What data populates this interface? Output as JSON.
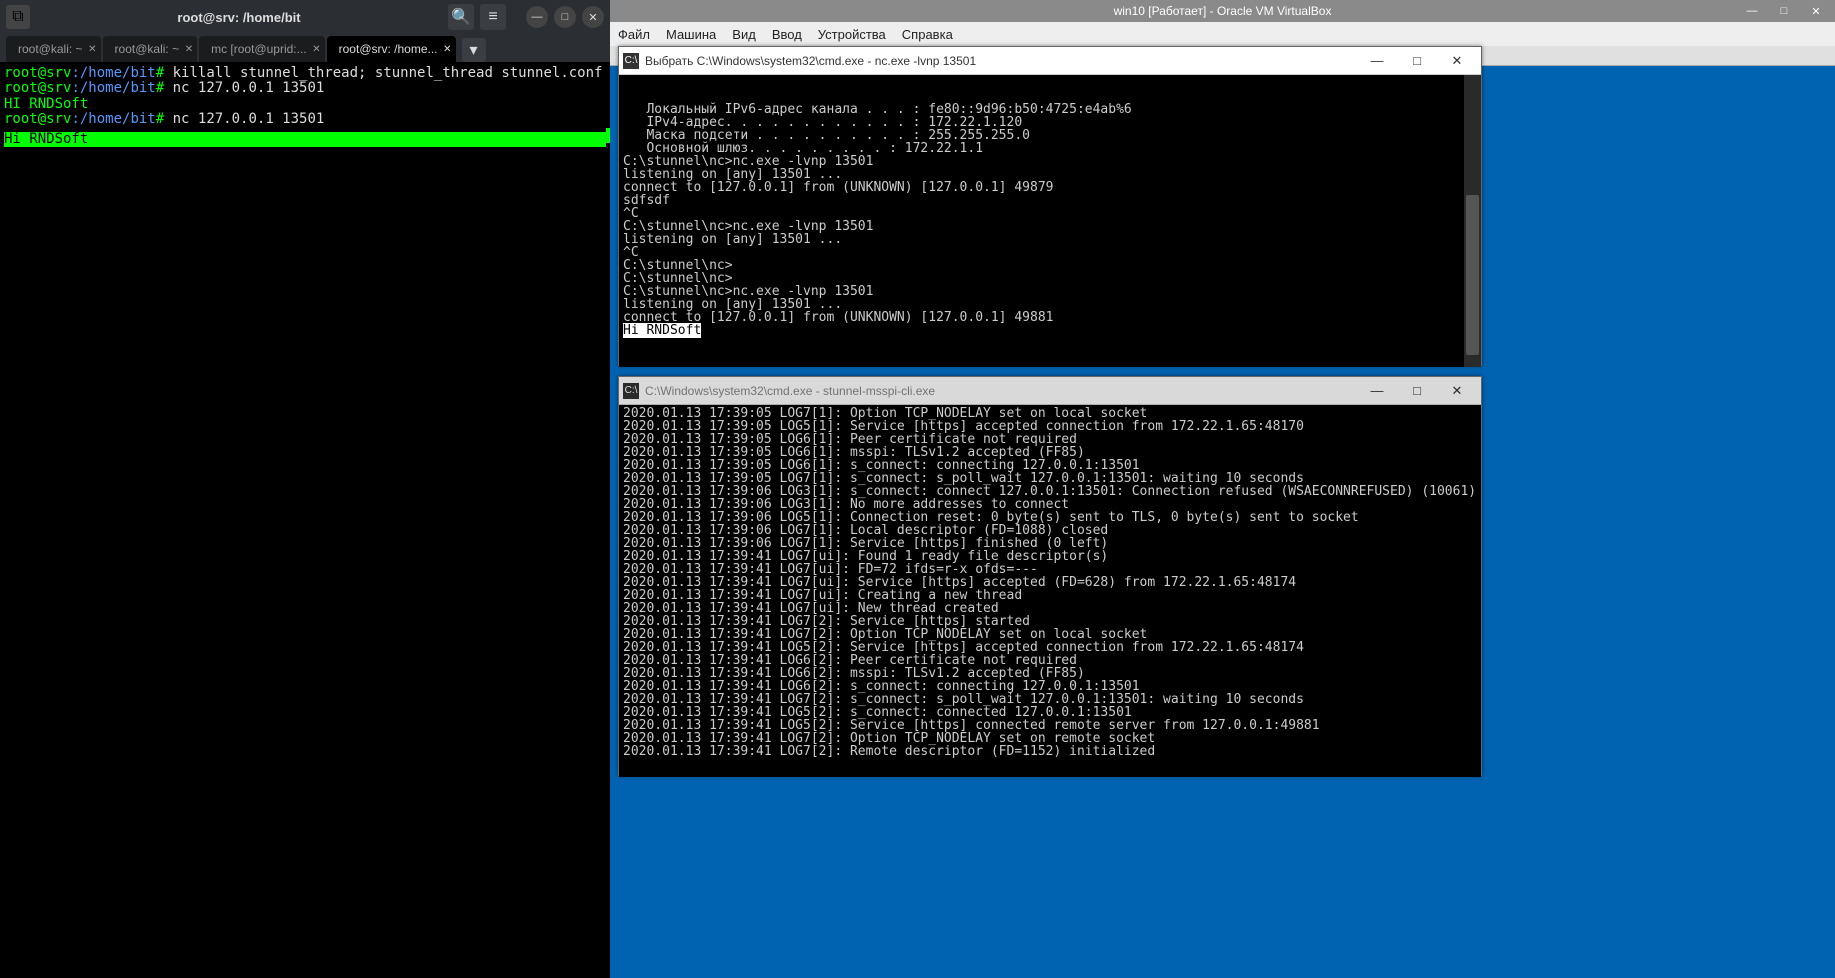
{
  "linux": {
    "titlebar": {
      "title": "root@srv: /home/bit"
    },
    "tabs": [
      {
        "label": "root@kali: ~",
        "active": false
      },
      {
        "label": "root@kali: ~",
        "active": false
      },
      {
        "label": "mc [root@uprid:...",
        "active": false
      },
      {
        "label": "root@srv: /home...",
        "active": true
      }
    ],
    "lines": [
      {
        "prompt_user": "root@srv",
        "prompt_path": ":/home/bit",
        "prompt_end": "#",
        "cmd": " killall stunnel_thread; stunnel_thread stunnel.conf"
      },
      {
        "prompt_user": "root@srv",
        "prompt_path": ":/home/bit",
        "prompt_end": "#",
        "cmd": " nc 127.0.0.1 13501"
      },
      {
        "output": "HI RNDSoft"
      },
      {
        "prompt_user": "root@srv",
        "prompt_path": ":/home/bit",
        "prompt_end": "#",
        "cmd": " nc 127.0.0.1 13501"
      },
      {
        "highlighted": "Hi RNDSoft"
      }
    ]
  },
  "vbox": {
    "titlebar": "win10 [Работает] - Oracle VM VirtualBox",
    "menu": [
      "Файл",
      "Машина",
      "Вид",
      "Ввод",
      "Устройства",
      "Справка"
    ],
    "cmd1": {
      "title": "Выбрать C:\\Windows\\system32\\cmd.exe - nc.exe  -lvnp 13501",
      "lines": [
        "   Локальный IPv6-адрес канала . . . : fe80::9d96:b50:4725:e4ab%6",
        "   IPv4-адрес. . . . . . . . . . . . : 172.22.1.120",
        "   Маска подсети . . . . . . . . . . : 255.255.255.0",
        "   Основной шлюз. . . . . . . . . : 172.22.1.1",
        "",
        "C:\\stunnel\\nc>nc.exe -lvnp 13501",
        "listening on [any] 13501 ...",
        "connect to [127.0.0.1] from (UNKNOWN) [127.0.0.1] 49879",
        "sdfsdf",
        "^C",
        "C:\\stunnel\\nc>nc.exe -lvnp 13501",
        "listening on [any] 13501 ...",
        "^C",
        "C:\\stunnel\\nc>",
        "",
        "C:\\stunnel\\nc>",
        "",
        "C:\\stunnel\\nc>nc.exe -lvnp 13501",
        "listening on [any] 13501 ...",
        "connect to [127.0.0.1] from (UNKNOWN) [127.0.0.1] 49881"
      ],
      "final_selected": "Hi RNDSoft"
    },
    "cmd2": {
      "title": "C:\\Windows\\system32\\cmd.exe - stunnel-msspi-cli.exe",
      "lines": [
        "2020.01.13 17:39:05 LOG7[1]: Option TCP_NODELAY set on local socket",
        "2020.01.13 17:39:05 LOG5[1]: Service [https] accepted connection from 172.22.1.65:48170",
        "2020.01.13 17:39:05 LOG6[1]: Peer certificate not required",
        "2020.01.13 17:39:05 LOG6[1]: msspi: TLSv1.2 accepted (FF85)",
        "2020.01.13 17:39:05 LOG6[1]: s_connect: connecting 127.0.0.1:13501",
        "2020.01.13 17:39:05 LOG7[1]: s_connect: s_poll_wait 127.0.0.1:13501: waiting 10 seconds",
        "2020.01.13 17:39:06 LOG3[1]: s_connect: connect 127.0.0.1:13501: Connection refused (WSAECONNREFUSED) (10061)",
        "2020.01.13 17:39:06 LOG3[1]: No more addresses to connect",
        "2020.01.13 17:39:06 LOG5[1]: Connection reset: 0 byte(s) sent to TLS, 0 byte(s) sent to socket",
        "2020.01.13 17:39:06 LOG7[1]: Local descriptor (FD=1088) closed",
        "2020.01.13 17:39:06 LOG7[1]: Service [https] finished (0 left)",
        "2020.01.13 17:39:41 LOG7[ui]: Found 1 ready file descriptor(s)",
        "2020.01.13 17:39:41 LOG7[ui]: FD=72 ifds=r-x ofds=---",
        "2020.01.13 17:39:41 LOG7[ui]: Service [https] accepted (FD=628) from 172.22.1.65:48174",
        "2020.01.13 17:39:41 LOG7[ui]: Creating a new thread",
        "2020.01.13 17:39:41 LOG7[ui]: New thread created",
        "2020.01.13 17:39:41 LOG7[2]: Service [https] started",
        "2020.01.13 17:39:41 LOG7[2]: Option TCP_NODELAY set on local socket",
        "2020.01.13 17:39:41 LOG5[2]: Service [https] accepted connection from 172.22.1.65:48174",
        "2020.01.13 17:39:41 LOG6[2]: Peer certificate not required",
        "2020.01.13 17:39:41 LOG6[2]: msspi: TLSv1.2 accepted (FF85)",
        "2020.01.13 17:39:41 LOG6[2]: s_connect: connecting 127.0.0.1:13501",
        "2020.01.13 17:39:41 LOG7[2]: s_connect: s_poll_wait 127.0.0.1:13501: waiting 10 seconds",
        "2020.01.13 17:39:41 LOG5[2]: s_connect: connected 127.0.0.1:13501",
        "2020.01.13 17:39:41 LOG5[2]: Service [https] connected remote server from 127.0.0.1:49881",
        "2020.01.13 17:39:41 LOG7[2]: Option TCP_NODELAY set on remote socket",
        "2020.01.13 17:39:41 LOG7[2]: Remote descriptor (FD=1152) initialized"
      ]
    }
  },
  "icons": {
    "terminal": "⧉",
    "search": "🔍",
    "menu": "≡",
    "minimize": "—",
    "maximize": "□",
    "close": "✕",
    "dropdown": "▾",
    "cmd": "C:\\"
  }
}
